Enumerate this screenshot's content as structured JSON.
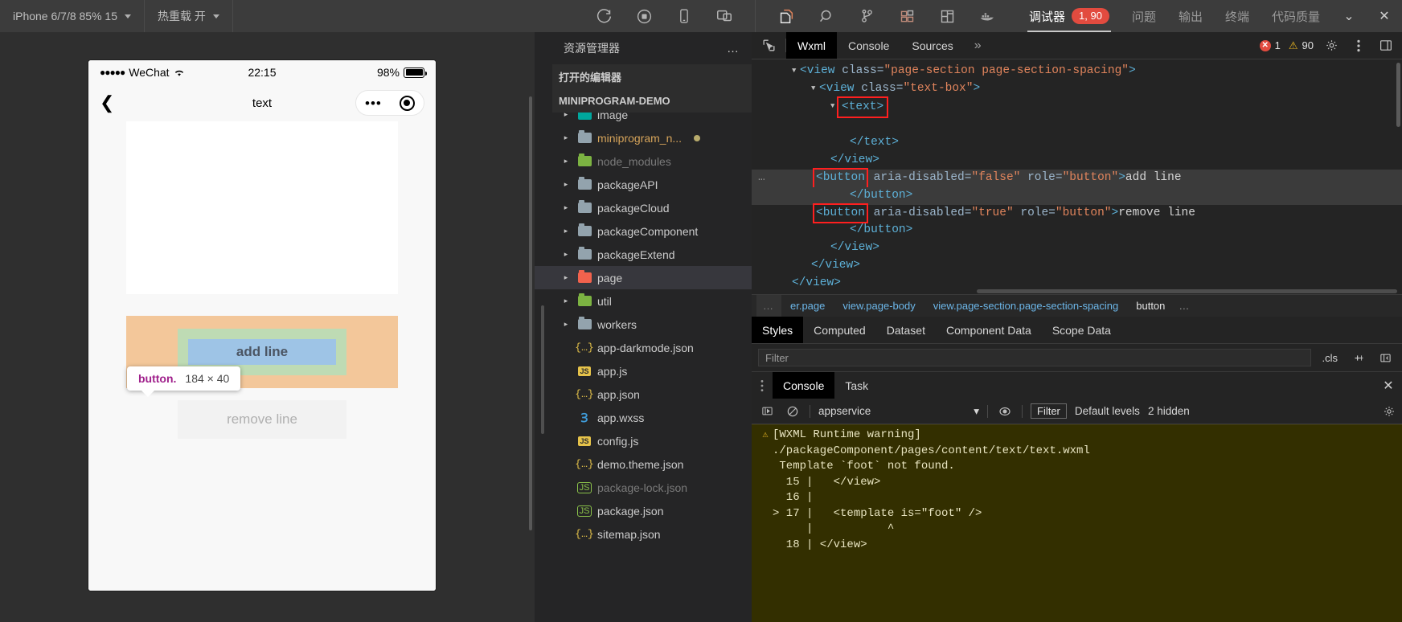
{
  "topbar": {
    "device_selector": "iPhone 6/7/8 85% 15",
    "hot_reload": "热重载 开",
    "icons_left": [
      "refresh-icon",
      "stop-record-icon",
      "phone-preview-icon",
      "multi-window-icon"
    ],
    "icons_activity": [
      "files-copy-icon",
      "search-icon",
      "source-control-icon",
      "extensions-icon",
      "layout-icon",
      "docker-icon"
    ],
    "tabs": [
      {
        "label": "调试器",
        "badge": "1, 90",
        "active": true
      },
      {
        "label": "问题",
        "badge": "",
        "active": false
      },
      {
        "label": "输出",
        "badge": "",
        "active": false
      },
      {
        "label": "终端",
        "badge": "",
        "active": false
      },
      {
        "label": "代码质量",
        "badge": "",
        "active": false
      }
    ],
    "window_minimize": "⌄",
    "window_close": "✕"
  },
  "simulator": {
    "status": {
      "carrier": "WeChat",
      "signal_dots": "●●●●●",
      "wifi": "",
      "time": "22:15",
      "battery_pct": "98%"
    },
    "nav": {
      "back": "❮",
      "title": "text",
      "capsule_dots": "•••"
    },
    "tooltip": {
      "tag": "button.",
      "size": "184 × 40"
    },
    "buttons": {
      "add_line": "add line",
      "remove_line": "remove line"
    }
  },
  "explorer": {
    "title": "资源管理器",
    "more": "…",
    "sections": [
      {
        "label": "打开的编辑器",
        "expanded": false
      },
      {
        "label": "MINIPROGRAM-DEMO",
        "expanded": true
      }
    ],
    "items": [
      {
        "label": "image",
        "type": "folder-image",
        "arrow": "▸",
        "selected": false,
        "dim": false,
        "modified": false
      },
      {
        "label": "miniprogram_n...",
        "type": "folder",
        "arrow": "▸",
        "selected": false,
        "dim": false,
        "modified": true
      },
      {
        "label": "node_modules",
        "type": "folder-node",
        "arrow": "▸",
        "selected": false,
        "dim": true,
        "modified": false
      },
      {
        "label": "packageAPI",
        "type": "folder",
        "arrow": "▸",
        "selected": false,
        "dim": false,
        "modified": false
      },
      {
        "label": "packageCloud",
        "type": "folder",
        "arrow": "▸",
        "selected": false,
        "dim": false,
        "modified": false
      },
      {
        "label": "packageComponent",
        "type": "folder",
        "arrow": "▸",
        "selected": false,
        "dim": false,
        "modified": false
      },
      {
        "label": "packageExtend",
        "type": "folder",
        "arrow": "▸",
        "selected": false,
        "dim": false,
        "modified": false
      },
      {
        "label": "page",
        "type": "folder-page",
        "arrow": "▸",
        "selected": true,
        "dim": false,
        "modified": false
      },
      {
        "label": "util",
        "type": "folder-util",
        "arrow": "▸",
        "selected": false,
        "dim": false,
        "modified": false
      },
      {
        "label": "workers",
        "type": "folder",
        "arrow": "▸",
        "selected": false,
        "dim": false,
        "modified": false
      },
      {
        "label": "app-darkmode.json",
        "type": "json",
        "arrow": "",
        "selected": false,
        "dim": false,
        "modified": false
      },
      {
        "label": "app.js",
        "type": "js",
        "arrow": "",
        "selected": false,
        "dim": false,
        "modified": false
      },
      {
        "label": "app.json",
        "type": "json",
        "arrow": "",
        "selected": false,
        "dim": false,
        "modified": false
      },
      {
        "label": "app.wxss",
        "type": "css",
        "arrow": "",
        "selected": false,
        "dim": false,
        "modified": false
      },
      {
        "label": "config.js",
        "type": "js",
        "arrow": "",
        "selected": false,
        "dim": false,
        "modified": false
      },
      {
        "label": "demo.theme.json",
        "type": "json",
        "arrow": "",
        "selected": false,
        "dim": false,
        "modified": false
      },
      {
        "label": "package-lock.json",
        "type": "npm",
        "arrow": "",
        "selected": false,
        "dim": true,
        "modified": false
      },
      {
        "label": "package.json",
        "type": "npm",
        "arrow": "",
        "selected": false,
        "dim": false,
        "modified": false
      },
      {
        "label": "sitemap.json",
        "type": "json",
        "arrow": "",
        "selected": false,
        "dim": false,
        "modified": false
      }
    ]
  },
  "devtools": {
    "picker_icon": "element-picker-icon",
    "tabs": [
      {
        "label": "Wxml",
        "active": true
      },
      {
        "label": "Console",
        "active": false
      },
      {
        "label": "Sources",
        "active": false
      }
    ],
    "overflow": "»",
    "error_count": "1",
    "warning_count": "90",
    "error_glyph": "✕",
    "warning_glyph": "⚠",
    "settings_icon": "gear-icon",
    "kebab_icon": "more-vertical-icon",
    "dock_icon": "dock-side-icon",
    "wxml_lines": [
      {
        "indent": 1,
        "arrow": "▼",
        "parts": [
          {
            "t": "tag",
            "v": "<view "
          },
          {
            "t": "attr",
            "v": "class="
          },
          {
            "t": "val",
            "v": "\"page-section page-section-spacing\""
          },
          {
            "t": "tag",
            "v": ">"
          }
        ],
        "highlight": false,
        "dots": false
      },
      {
        "indent": 2,
        "arrow": "▼",
        "parts": [
          {
            "t": "tag",
            "v": "<view "
          },
          {
            "t": "attr",
            "v": "class="
          },
          {
            "t": "val",
            "v": "\"text-box\""
          },
          {
            "t": "tag",
            "v": ">"
          }
        ],
        "highlight": false,
        "dots": false
      },
      {
        "indent": 3,
        "arrow": "▼",
        "parts": [
          {
            "t": "boxed",
            "v": "<text>"
          }
        ],
        "highlight": false,
        "dots": false
      },
      {
        "indent": 3,
        "arrow": "",
        "parts": [],
        "highlight": false,
        "dots": false
      },
      {
        "indent": 4,
        "arrow": "",
        "parts": [
          {
            "t": "tag",
            "v": "</text>"
          }
        ],
        "highlight": false,
        "dots": false
      },
      {
        "indent": 3,
        "arrow": "",
        "parts": [
          {
            "t": "tag",
            "v": "</view>"
          }
        ],
        "highlight": false,
        "dots": false
      },
      {
        "indent": 3,
        "arrow": "",
        "parts": [
          {
            "t": "boxed",
            "v": "<button"
          },
          {
            "t": "attr",
            "v": " aria-disabled="
          },
          {
            "t": "val",
            "v": "\"false\""
          },
          {
            "t": "attr",
            "v": " role="
          },
          {
            "t": "val",
            "v": "\"button\""
          },
          {
            "t": "tag",
            "v": ">"
          },
          {
            "t": "text",
            "v": "add line"
          }
        ],
        "highlight": true,
        "dots": true
      },
      {
        "indent": 4,
        "arrow": "",
        "parts": [
          {
            "t": "tag",
            "v": "</button>"
          }
        ],
        "highlight": true,
        "dots": false
      },
      {
        "indent": 3,
        "arrow": "",
        "parts": [
          {
            "t": "boxed",
            "v": "<button"
          },
          {
            "t": "attr",
            "v": " aria-disabled="
          },
          {
            "t": "val",
            "v": "\"true\""
          },
          {
            "t": "attr",
            "v": " role="
          },
          {
            "t": "val",
            "v": "\"button\""
          },
          {
            "t": "tag",
            "v": ">"
          },
          {
            "t": "text",
            "v": "remove line"
          }
        ],
        "highlight": false,
        "dots": false
      },
      {
        "indent": 4,
        "arrow": "",
        "parts": [
          {
            "t": "tag",
            "v": "</button>"
          }
        ],
        "highlight": false,
        "dots": false
      },
      {
        "indent": 3,
        "arrow": "",
        "parts": [
          {
            "t": "tag",
            "v": "</view>"
          }
        ],
        "highlight": false,
        "dots": false
      },
      {
        "indent": 2,
        "arrow": "",
        "parts": [
          {
            "t": "tag",
            "v": "</view>"
          }
        ],
        "highlight": false,
        "dots": false
      },
      {
        "indent": 1,
        "arrow": "",
        "parts": [
          {
            "t": "tag",
            "v": "</view>"
          }
        ],
        "highlight": false,
        "dots": false
      }
    ],
    "breadcrumb": {
      "lead": "…",
      "items": [
        "er.page",
        "view.page-body",
        "view.page-section.page-section-spacing",
        "button"
      ],
      "trail": "…"
    },
    "styles_tabs": [
      {
        "label": "Styles",
        "active": true
      },
      {
        "label": "Computed",
        "active": false
      },
      {
        "label": "Dataset",
        "active": false
      },
      {
        "label": "Component Data",
        "active": false
      },
      {
        "label": "Scope Data",
        "active": false
      }
    ],
    "style_filter_placeholder": "Filter",
    "cls_label": ".cls",
    "plus_label": "+",
    "panel_toggle_icon": "new-style-rule-icon",
    "console_tabs": [
      {
        "label": "Console",
        "active": true
      },
      {
        "label": "Task",
        "active": false
      }
    ],
    "console_close": "✕",
    "console_toolbar": {
      "execute_icon": "execution-context-icon",
      "clear_icon": "clear-console-icon",
      "context": "appservice",
      "context_caret": "▾",
      "eye_icon": "live-expression-icon",
      "filter_label": "Filter",
      "levels_label": "Default levels",
      "hidden_label": "2 hidden",
      "settings_icon": "console-settings-icon"
    },
    "console_log": [
      {
        "icon": "warning-icon",
        "text": "[WXML Runtime warning]",
        "indent": false
      },
      {
        "icon": "",
        "text": "./packageComponent/pages/content/text/text.wxml",
        "indent": true
      },
      {
        "icon": "",
        "text": " Template `foot` not found.",
        "indent": true
      },
      {
        "icon": "",
        "text": "  15 |   </view>",
        "indent": true
      },
      {
        "icon": "",
        "text": "  16 |",
        "indent": true
      },
      {
        "icon": "",
        "text": "> 17 |   <template is=\"foot\" />",
        "indent": true
      },
      {
        "icon": "",
        "text": "     |           ^",
        "indent": true
      },
      {
        "icon": "",
        "text": "  18 | </view>",
        "indent": true
      }
    ]
  },
  "colors": {
    "accent_red": "#e24b3f",
    "warn_yellow": "#e6b422",
    "tag_blue": "#5db0d7",
    "value_orange": "#e0845c",
    "highlight_orange": "#f3c79a",
    "highlight_green": "#bedbb4",
    "highlight_blue": "#9ec4e6",
    "tooltip_magenta": "#a0218c"
  }
}
